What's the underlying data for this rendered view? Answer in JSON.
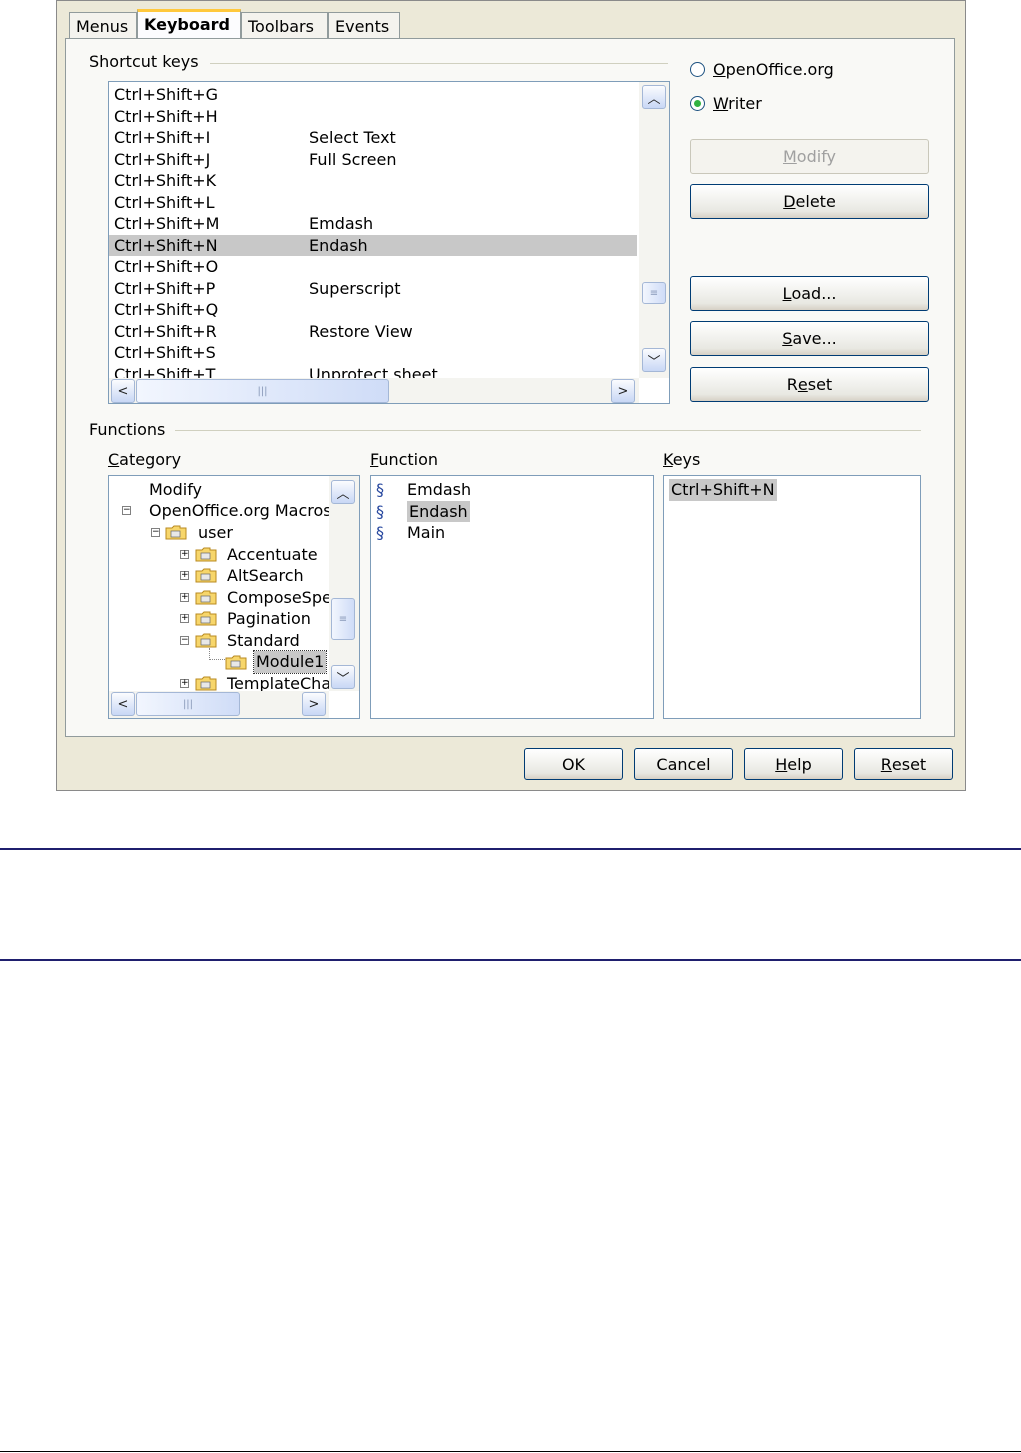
{
  "tabs": [
    "Menus",
    "Keyboard",
    "Toolbars",
    "Events"
  ],
  "active_tab": "Keyboard",
  "shortcut_keys": {
    "group_label": "Shortcut keys",
    "rows": [
      {
        "key": "Ctrl+Shift+G",
        "function": ""
      },
      {
        "key": "Ctrl+Shift+H",
        "function": ""
      },
      {
        "key": "Ctrl+Shift+I",
        "function": "Select Text"
      },
      {
        "key": "Ctrl+Shift+J",
        "function": "Full Screen"
      },
      {
        "key": "Ctrl+Shift+K",
        "function": ""
      },
      {
        "key": "Ctrl+Shift+L",
        "function": ""
      },
      {
        "key": "Ctrl+Shift+M",
        "function": "Emdash"
      },
      {
        "key": "Ctrl+Shift+N",
        "function": "Endash",
        "selected": true
      },
      {
        "key": "Ctrl+Shift+O",
        "function": ""
      },
      {
        "key": "Ctrl+Shift+P",
        "function": "Superscript"
      },
      {
        "key": "Ctrl+Shift+Q",
        "function": ""
      },
      {
        "key": "Ctrl+Shift+R",
        "function": "Restore View"
      },
      {
        "key": "Ctrl+Shift+S",
        "function": ""
      },
      {
        "key": "Ctrl+Shift+T",
        "function": "Unprotect sheet"
      }
    ]
  },
  "scope": {
    "options": [
      {
        "label": "OpenOffice.org",
        "mnemonic": "O",
        "rest": "penOffice.org",
        "checked": false
      },
      {
        "label": "Writer",
        "mnemonic": "W",
        "rest": "riter",
        "checked": true
      }
    ]
  },
  "side_buttons": {
    "modify": {
      "m": "M",
      "rest": "odify"
    },
    "delete": {
      "m": "D",
      "rest": "elete"
    },
    "load": {
      "m": "L",
      "rest": "oad..."
    },
    "save": {
      "m": "S",
      "rest": "ave..."
    },
    "reset": {
      "pre": "R",
      "m": "e",
      "rest": "set"
    }
  },
  "functions": {
    "group_label": "Functions",
    "category_label": {
      "m": "C",
      "rest": "ategory"
    },
    "function_label": {
      "m": "F",
      "rest": "unction"
    },
    "keys_label": {
      "m": "K",
      "rest": "eys"
    },
    "category_tree": [
      {
        "label": "Modify"
      },
      {
        "label": "OpenOffice.org Macros"
      },
      {
        "label": "user"
      },
      {
        "label": "Accentuate"
      },
      {
        "label": "AltSearch"
      },
      {
        "label": "ComposeSpecial"
      },
      {
        "label": "Pagination"
      },
      {
        "label": "Standard"
      },
      {
        "label": "Module1"
      },
      {
        "label": "TemplateChanger"
      }
    ],
    "function_list": [
      "Emdash",
      "Endash",
      "Main"
    ],
    "selected_function": "Endash",
    "keys_list": [
      "Ctrl+Shift+N"
    ]
  },
  "footer_buttons": {
    "ok": "OK",
    "cancel": "Cancel",
    "help": {
      "m": "H",
      "rest": "elp"
    },
    "reset": {
      "m": "R",
      "rest": "eset"
    }
  }
}
